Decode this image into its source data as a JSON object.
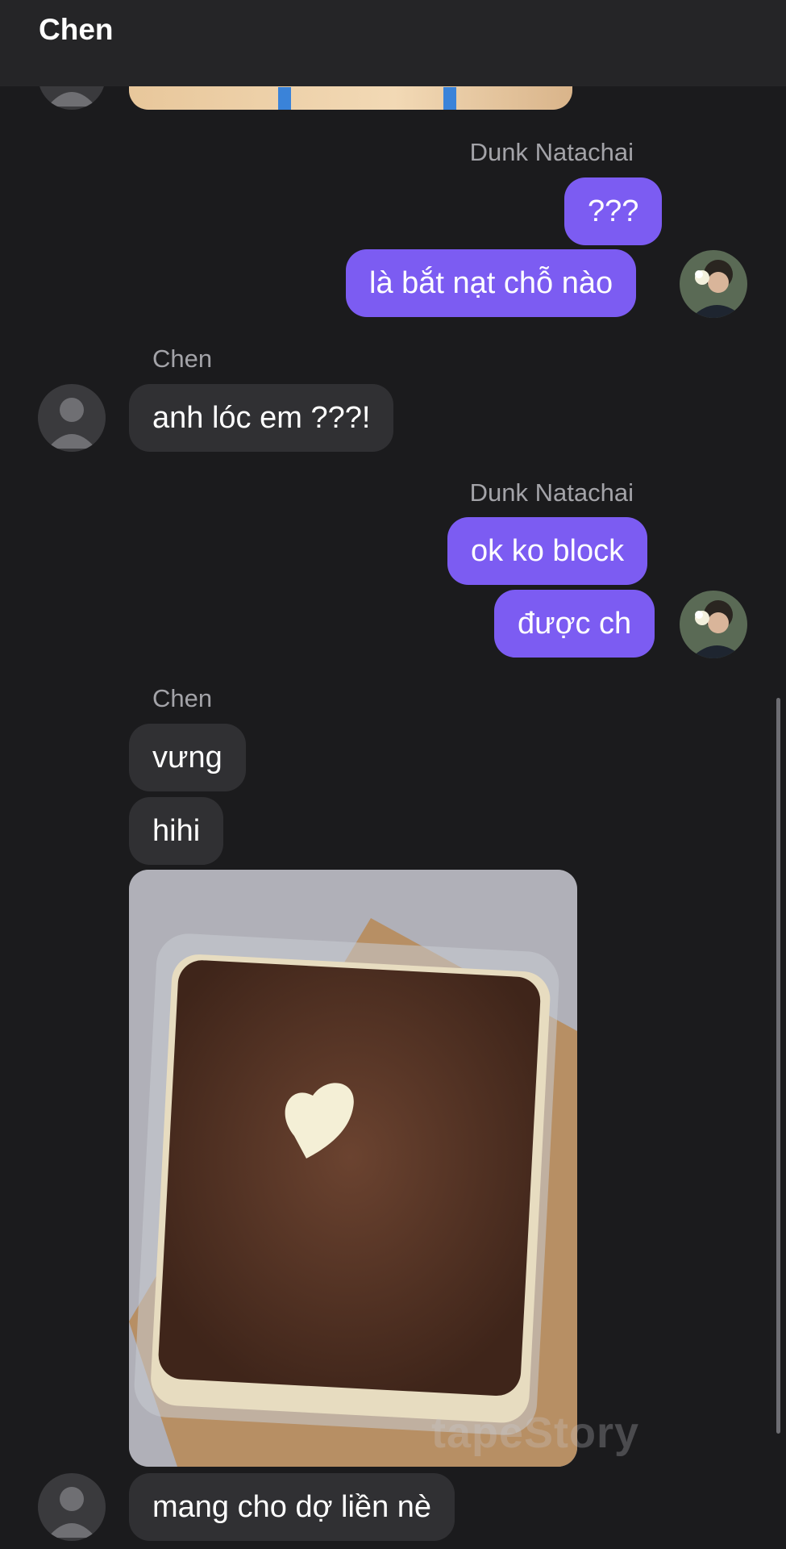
{
  "header": {
    "title": "Chen"
  },
  "contacts": {
    "them": "Chen",
    "me": "Dunk Natachai"
  },
  "messages": {
    "m1": "???",
    "m2": "là bắt nạt chỗ nào",
    "m3": "anh lóc em ???!",
    "m4": "ok ko block",
    "m5": "được ch",
    "m6": "vưng",
    "m7": "hihi",
    "m8": "mang cho dợ liền nè"
  },
  "watermark": "tapeStory",
  "colors": {
    "background": "#1b1b1d",
    "header": "#252527",
    "incoming_bubble": "#303033",
    "outgoing_bubble": "#7c5cf2",
    "name_text": "#a3a3a8"
  },
  "icons": {
    "default_avatar": "person-silhouette-icon"
  }
}
